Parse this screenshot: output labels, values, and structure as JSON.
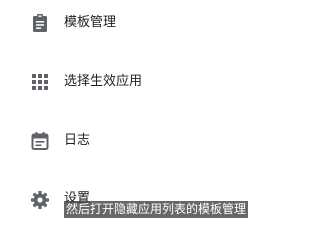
{
  "menu": {
    "items": [
      {
        "label": "模板管理",
        "icon": "clipboard-icon"
      },
      {
        "label": "选择生效应用",
        "icon": "apps-grid-icon"
      },
      {
        "label": "日志",
        "icon": "calendar-log-icon"
      },
      {
        "label": "设置",
        "icon": "gear-icon"
      }
    ]
  },
  "caption": {
    "text": "然后打开隐藏应用列表的模板管理"
  },
  "colors": {
    "icon": "#5f6368",
    "text": "#202020",
    "caption_bg": "#3c3c3c"
  }
}
